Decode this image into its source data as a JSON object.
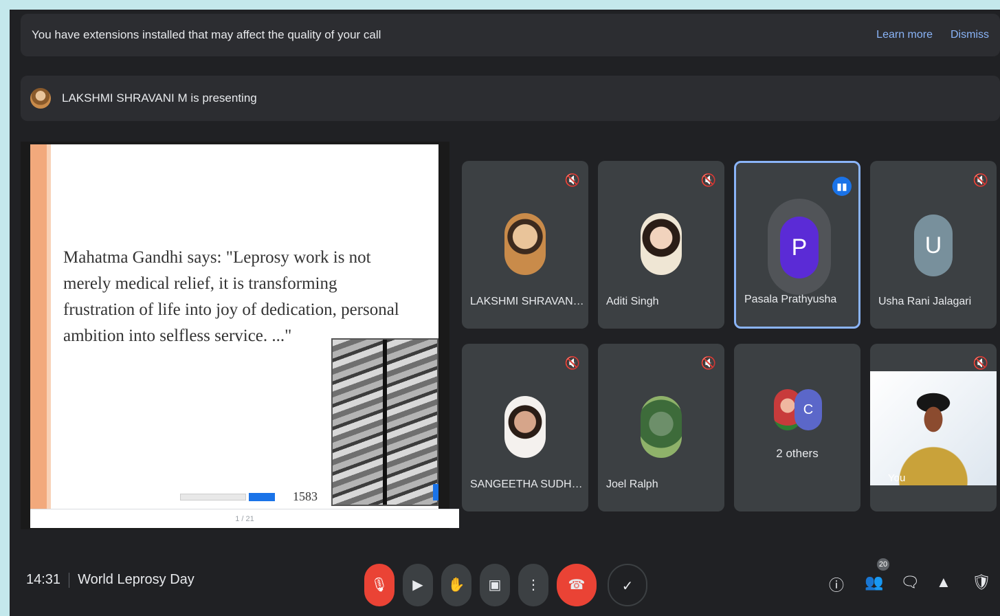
{
  "banner": {
    "message": "You have extensions installed that may affect the quality of your call",
    "learn_more": "Learn more",
    "dismiss": "Dismiss"
  },
  "presenter": {
    "text": "LAKSHMI SHRAVANI M is presenting"
  },
  "slide": {
    "quote": "Mahatma Gandhi says: \"Leprosy work is not merely medical relief, it is transforming frustration of life into joy of dedication, personal ambition into selfless service. ...\"",
    "year": "1583",
    "strip_text": "1 / 21"
  },
  "participants": [
    {
      "name": "LAKSHMI SHRAVANI M",
      "status_icon": "mic-off-icon"
    },
    {
      "name": "Aditi Singh",
      "status_icon": "mic-off-icon"
    },
    {
      "name": "Pasala Prathyusha",
      "initial": "P",
      "status_icon": "speaking-icon"
    },
    {
      "name": "Usha Rani Jalagari",
      "initial": "U",
      "status_icon": "mic-off-icon"
    },
    {
      "name": "SANGEETHA SUDHA ...",
      "status_icon": "mic-off-icon"
    },
    {
      "name": "Joel Ralph",
      "status_icon": "mic-off-icon"
    },
    {
      "name": "2 others",
      "initial": "C"
    },
    {
      "name": "You",
      "status_icon": "mic-off-icon"
    }
  ],
  "meeting": {
    "time": "14:31",
    "title": "World Leprosy Day"
  },
  "badge_count": "20",
  "colors": {
    "background": "#202124",
    "tile": "#3c4043",
    "accent": "#8ab4f8",
    "danger": "#ea4335",
    "avatar_p": "#5b2bd6",
    "avatar_u": "#78909c"
  }
}
